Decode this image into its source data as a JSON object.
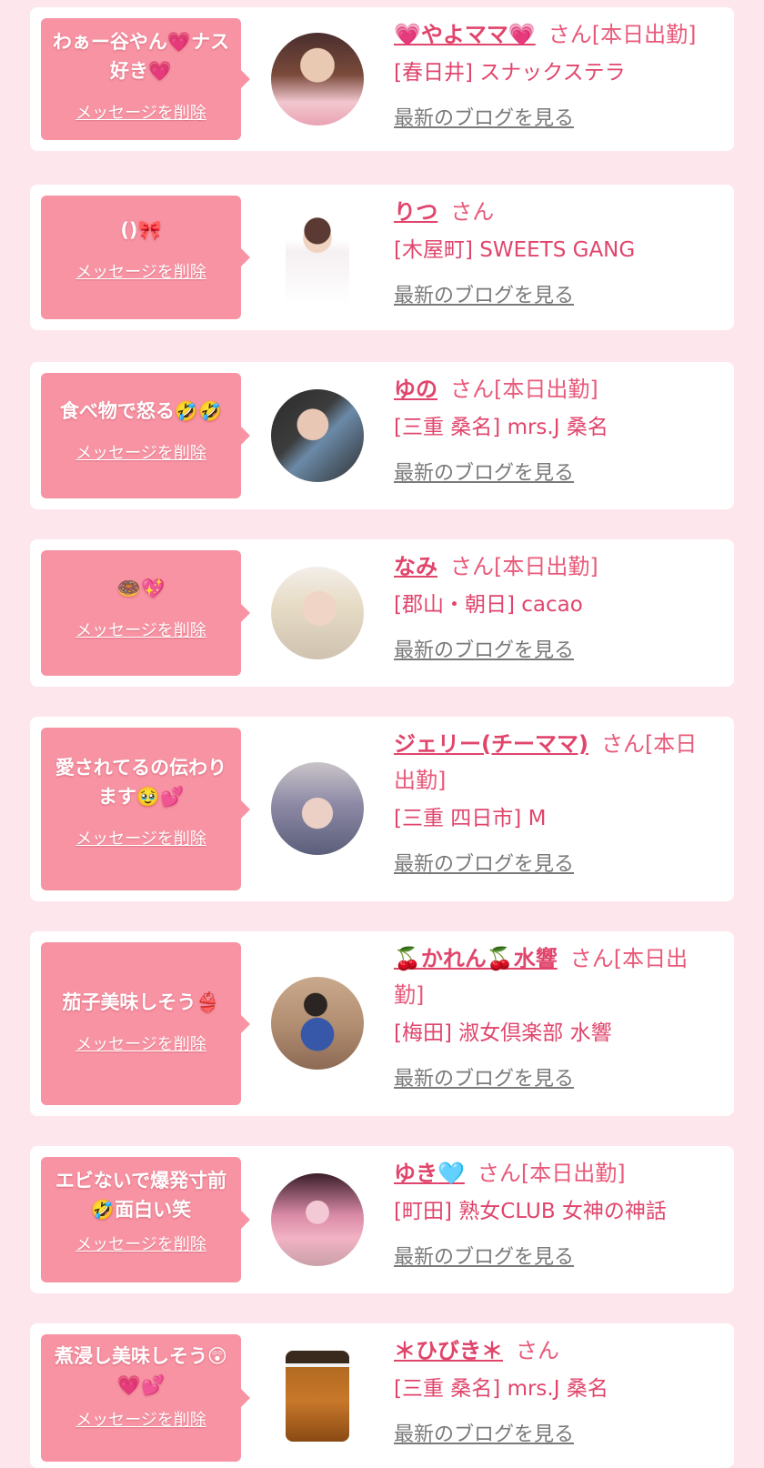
{
  "delete_label": "メッセージを削除",
  "honorific": "さん",
  "blog_label": "最新のブログを見る",
  "colors": {
    "bubble": "#f893a3",
    "accent": "#e0456c",
    "background": "#fde6ec"
  },
  "items": [
    {
      "message": "わぁー谷やん💗ナス好き💗",
      "name": "💗やよママ💗",
      "status": "[本日出勤]",
      "shop": "[春日井] スナックステラ"
    },
    {
      "message": "(⁠⁠⁠⁠⁠⁠⁠)⁠🎀",
      "name": "りつ",
      "status": "",
      "shop": "[木屋町] SWEETS GANG"
    },
    {
      "message": "食べ物で怒る🤣🤣",
      "name": "ゆの",
      "status": "[本日出勤]",
      "shop": "[三重 桑名] mrs.J 桑名"
    },
    {
      "message": "🍩💖",
      "name": "なみ",
      "status": "[本日出勤]",
      "shop": "[郡山・朝日] cacao"
    },
    {
      "message": "愛されてるの伝わります🥹💕",
      "name": "ジェリー(チーママ)",
      "status": "[本日出勤]",
      "shop": "[三重 四日市] M"
    },
    {
      "message": "茄子美味しそう👙",
      "name": "🍒かれん🍒水響",
      "status": "[本日出勤]",
      "shop": "[梅田] 淑女倶楽部 水響"
    },
    {
      "message": "エビないで爆発寸前🤣面白い笑",
      "name": "ゆき🩵",
      "status": "[本日出勤]",
      "shop": "[町田] 熟女CLUB 女神の神話"
    },
    {
      "message": "煮浸し美味しそう😲💗💕",
      "name": "＊ひびき＊",
      "status": "",
      "shop": "[三重 桑名] mrs.J 桑名"
    }
  ]
}
